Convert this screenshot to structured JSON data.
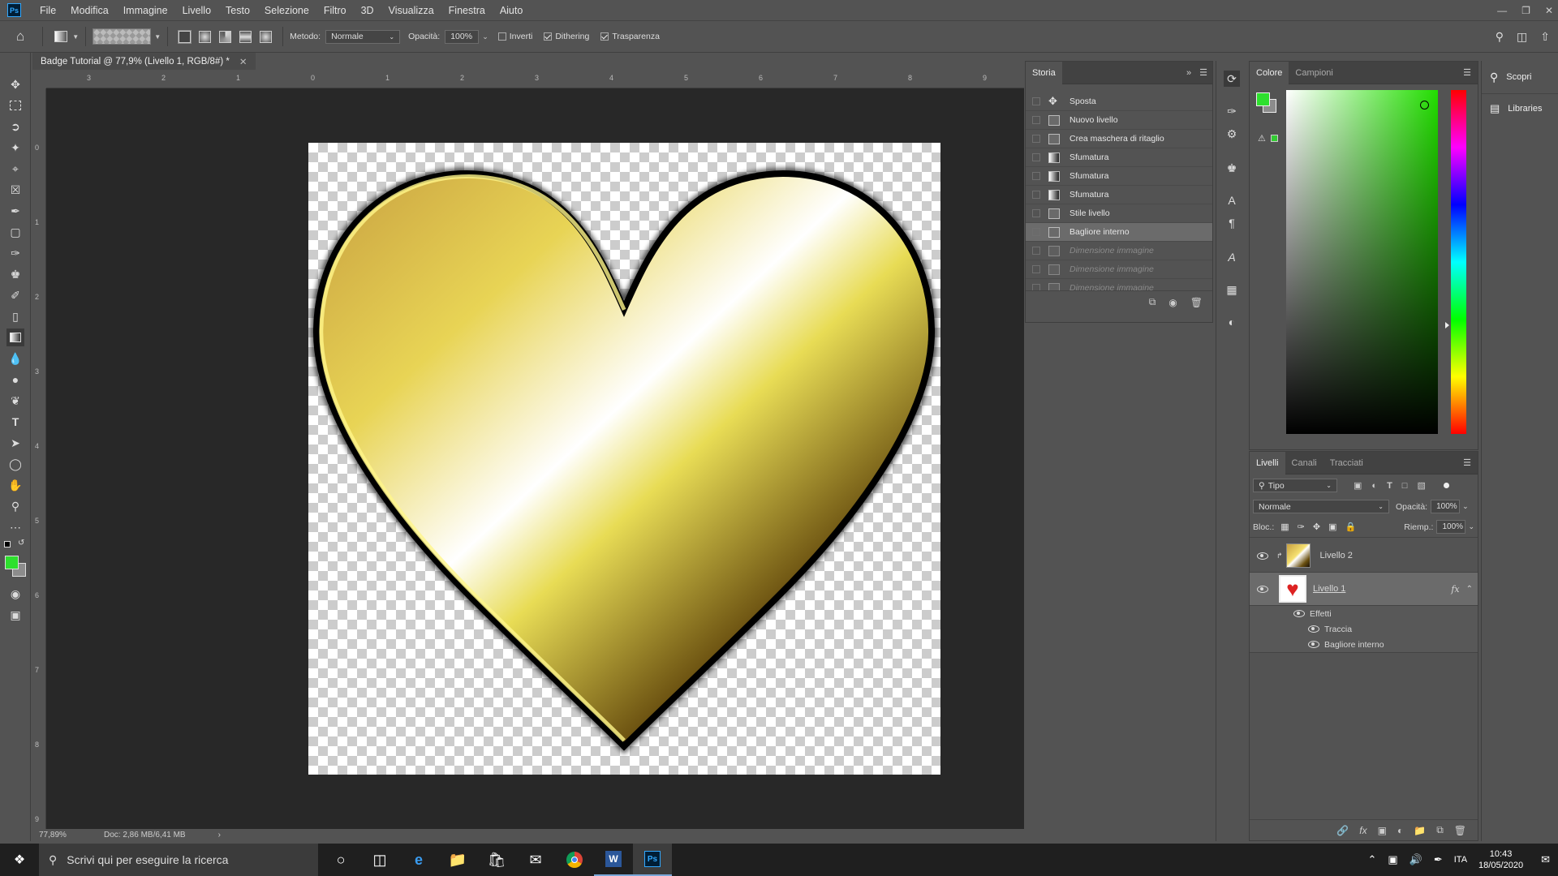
{
  "app": {
    "logo": "Ps",
    "menu": [
      "File",
      "Modifica",
      "Immagine",
      "Livello",
      "Testo",
      "Selezione",
      "Filtro",
      "3D",
      "Visualizza",
      "Finestra",
      "Aiuto"
    ]
  },
  "options": {
    "metodo_label": "Metodo:",
    "metodo_value": "Normale",
    "opacita_label": "Opacità:",
    "opacita_value": "100%",
    "inverti": "Inverti",
    "dithering": "Dithering",
    "trasparenza": "Trasparenza",
    "inverti_checked": false,
    "dithering_checked": true,
    "trasparenza_checked": true
  },
  "document": {
    "tab_title": "Badge Tutorial @ 77,9% (Livello 1, RGB/8#) *",
    "zoom": "77,89%",
    "doc_info": "Doc: 2,86 MB/6,41 MB"
  },
  "rulers": {
    "h": [
      "3",
      "2",
      "1",
      "0",
      "1",
      "2",
      "3",
      "4",
      "5",
      "6",
      "7",
      "8",
      "9"
    ],
    "v": [
      "0",
      "1",
      "2",
      "3",
      "4",
      "5",
      "6",
      "7",
      "8",
      "9"
    ]
  },
  "storia": {
    "title": "Storia",
    "items": [
      {
        "label": "Sposta",
        "icon": "move-icon",
        "state": "normal"
      },
      {
        "label": "Nuovo livello",
        "icon": "layer-icon",
        "state": "normal"
      },
      {
        "label": "Crea maschera di ritaglio",
        "icon": "layer-icon",
        "state": "normal"
      },
      {
        "label": "Sfumatura",
        "icon": "gradient-icon",
        "state": "normal"
      },
      {
        "label": "Sfumatura",
        "icon": "gradient-icon",
        "state": "normal"
      },
      {
        "label": "Sfumatura",
        "icon": "gradient-icon",
        "state": "normal"
      },
      {
        "label": "Stile livello",
        "icon": "layer-icon",
        "state": "normal"
      },
      {
        "label": "Bagliore interno",
        "icon": "layer-icon",
        "state": "current"
      },
      {
        "label": "Dimensione immagine",
        "icon": "layer-icon",
        "state": "dim"
      },
      {
        "label": "Dimensione immagine",
        "icon": "layer-icon",
        "state": "dim"
      },
      {
        "label": "Dimensione immagine",
        "icon": "layer-icon",
        "state": "dim"
      }
    ]
  },
  "colore": {
    "tabs": [
      "Colore",
      "Campioni"
    ],
    "foreground": "#2ee02e",
    "background": "#8c8c8c",
    "hue_color": "#22dd00"
  },
  "livelli": {
    "tabs": [
      "Livelli",
      "Canali",
      "Tracciati"
    ],
    "filter_label": "Tipo",
    "blend_mode": "Normale",
    "opacita_label": "Opacità:",
    "opacita_value": "100%",
    "bloc_label": "Bloc.:",
    "riemp_label": "Riemp.:",
    "riemp_value": "100%",
    "layers": [
      {
        "name": "Livello 2",
        "thumb": "gold"
      },
      {
        "name": "Livello 1",
        "thumb": "heart",
        "fx": "fx"
      }
    ],
    "effects_label": "Effetti",
    "effects": [
      "Traccia",
      "Bagliore interno"
    ]
  },
  "side": {
    "scopri": "Scopri",
    "libraries": "Libraries"
  },
  "taskbar": {
    "search": "Scrivi qui per eseguire la ricerca",
    "lang": "ITA",
    "time": "10:43",
    "date": "18/05/2020"
  }
}
